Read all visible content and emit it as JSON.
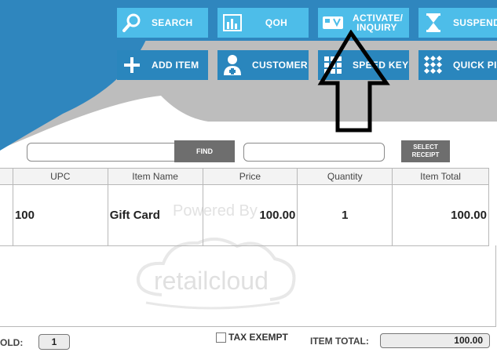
{
  "toolbar": {
    "row1": [
      {
        "label": "SEARCH",
        "icon": "search-icon"
      },
      {
        "label": "QOH",
        "icon": "bar-chart-icon"
      },
      {
        "label": "ACTIVATE/ INQUIRY",
        "icon": "gift-card-icon"
      },
      {
        "label": "SUSPEND",
        "icon": "hourglass-icon"
      }
    ],
    "row2": [
      {
        "label": "ADD ITEM",
        "icon": "plus-icon"
      },
      {
        "label": "CUSTOMER",
        "icon": "customer-add-icon"
      },
      {
        "label": "SPEED KEYS",
        "icon": "keypad-icon"
      },
      {
        "label": "QUICK PICK",
        "icon": "grid-icon"
      }
    ]
  },
  "search": {
    "left_value": "",
    "find_label": "FIND",
    "right_value": "",
    "select_receipt_label": "SELECT RECEIPT"
  },
  "table": {
    "headers": [
      "UPC",
      "Item Name",
      "Price",
      "Quantity",
      "Item Total"
    ],
    "rows": [
      {
        "upc": "100",
        "item_name": "Gift Card",
        "price": "100.00",
        "quantity": "1",
        "item_total": "100.00"
      }
    ]
  },
  "watermark": {
    "powered_by": "Powered By",
    "brand": "retailcloud"
  },
  "footer": {
    "sold_label": "OLD:",
    "sold_value": "1",
    "tax_exempt_label": "TAX EXEMPT",
    "tax_exempt_checked": false,
    "item_total_label": "ITEM TOTAL:",
    "item_total_value": "100.00"
  },
  "colors": {
    "header_blue": "#2f86be",
    "button_light": "#4dbde9",
    "button_dark": "#2a86bd",
    "gray_band": "#bdbdbd",
    "find_gray": "#6e6e6e"
  }
}
